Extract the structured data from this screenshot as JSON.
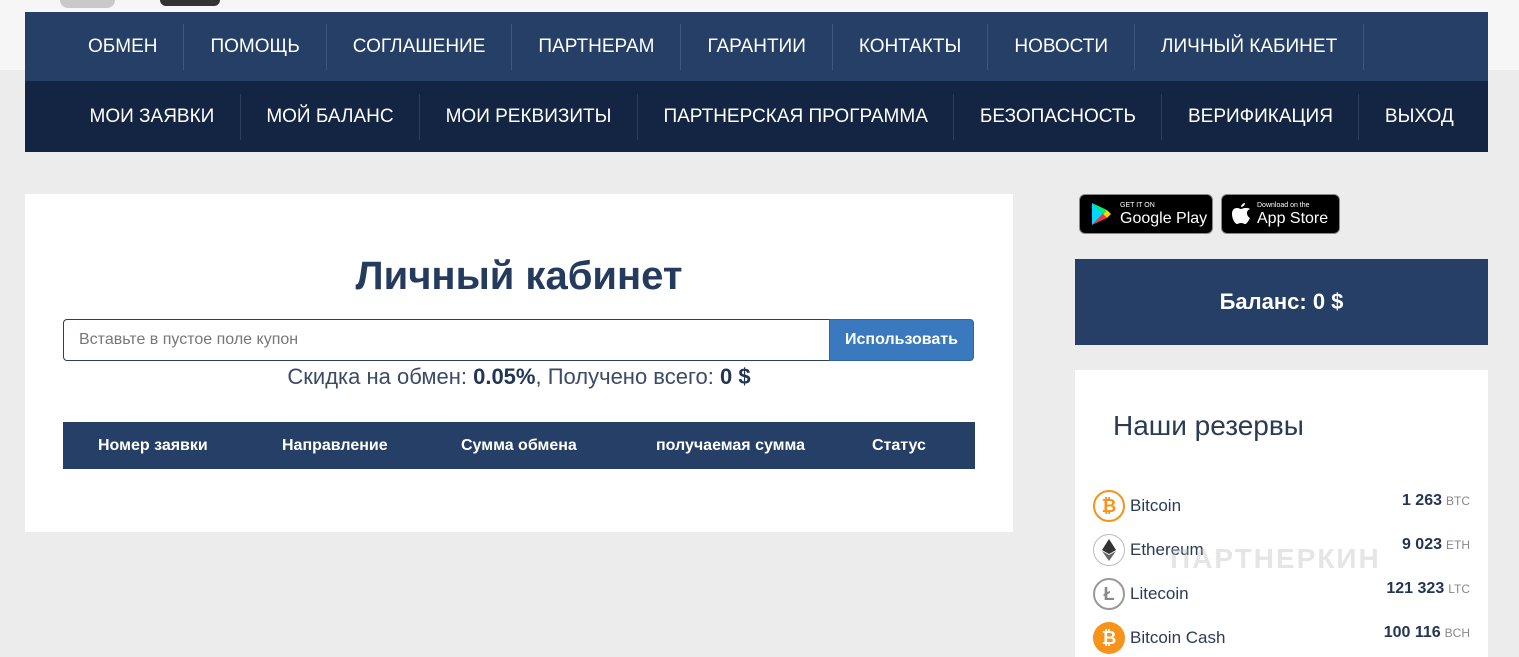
{
  "nav_top": [
    "ОБМЕН",
    "ПОМОЩЬ",
    "СОГЛАШЕНИЕ",
    "ПАРТНЕРАМ",
    "ГАРАНТИИ",
    "КОНТАКТЫ",
    "НОВОСТИ",
    "ЛИЧНЫЙ КАБИНЕТ"
  ],
  "nav_account": [
    "МОИ ЗАЯВКИ",
    "МОЙ БАЛАНС",
    "МОИ РЕКВИЗИТЫ",
    "ПАРТНЕРСКАЯ ПРОГРАММА",
    "БЕЗОПАСНОСТЬ",
    "ВЕРИФИКАЦИЯ",
    "ВЫХОД"
  ],
  "page": {
    "title": "Личный кабинет",
    "coupon_placeholder": "Вставьте в пустое поле купон",
    "coupon_button": "Использовать",
    "discount_label": "Скидка на обмен:",
    "discount_value": "0.05%",
    "received_label": ", Получено всего:",
    "received_value": "0 $"
  },
  "orders_table": {
    "headers": [
      "Номер заявки",
      "Направление",
      "Сумма обмена",
      "получаемая сумма",
      "Статус"
    ]
  },
  "stores": {
    "google_small": "GET IT ON",
    "google_big": "Google Play",
    "apple_small": "Download on the",
    "apple_big": "App Store"
  },
  "balance": "Баланс: 0 $",
  "reserves": {
    "title": "Наши резервы",
    "items": [
      {
        "name": "Bitcoin",
        "amount": "1 263",
        "unit": "BTC",
        "icon": "bitcoin-icon",
        "color": "#f7931a"
      },
      {
        "name": "Ethereum",
        "amount": "9 023",
        "unit": "ETH",
        "icon": "ethereum-icon",
        "color": "#333333"
      },
      {
        "name": "Litecoin",
        "amount": "121 323",
        "unit": "LTC",
        "icon": "litecoin-icon",
        "color": "#999999"
      },
      {
        "name": "Bitcoin Cash",
        "amount": "100 116",
        "unit": "BCH",
        "icon": "bitcoin-cash-icon",
        "color": "#f7931a"
      }
    ]
  },
  "watermark": "ПАРТНЕРКИН"
}
